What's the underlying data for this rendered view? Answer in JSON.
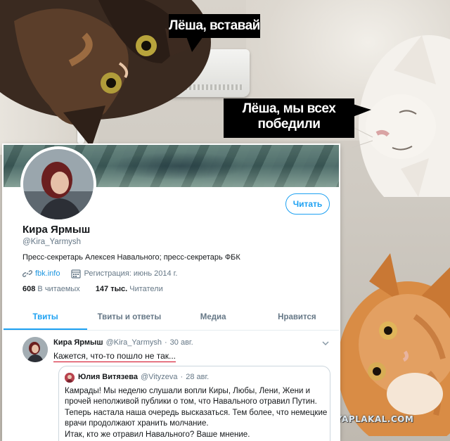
{
  "meme": {
    "caption_top": "Лёша, вставай",
    "caption_middle": "Лёша, мы всех победили",
    "watermark": "YAPLAKAL.COM"
  },
  "profile": {
    "follow_label": "Читать",
    "name": "Кира Ярмыш",
    "handle": "@Kira_Yarmysh",
    "bio": "Пресс-секретарь Алексея Навального; пресс-секретарь ФБК",
    "website": "fbk.info",
    "joined": "Регистрация: июнь 2014 г.",
    "following_count": "608",
    "following_label": "В читаемых",
    "followers_count": "147 тыс.",
    "followers_label": "Читатели"
  },
  "tabs": [
    {
      "label": "Твиты",
      "active": true
    },
    {
      "label": "Твиты и ответы",
      "active": false
    },
    {
      "label": "Медиа",
      "active": false
    },
    {
      "label": "Нравится",
      "active": false
    }
  ],
  "tweet": {
    "author": "Кира Ярмыш",
    "handle": "@Kira_Yarmysh",
    "sep": "·",
    "date": "30 авг.",
    "text": "Кажется, что-то пошло не так...",
    "quote": {
      "author": "Юлия Витязева",
      "handle": "@Vityzeva",
      "sep": "·",
      "date": "28 авг.",
      "text_lines": [
        "Камрады! Мы неделю слушали вопли Киры, Любы, Лени, Жени и",
        "прочей неполживой публики о том, что Навального отравил Путин.",
        "Теперь настала наша очередь высказаться. Тем более, что немецкие",
        "врачи продолжают хранить молчание.",
        "Итак, кто же отравил Навального? Ваше мнение."
      ]
    }
  },
  "colors": {
    "twitter_blue": "#1da1f2",
    "caption_bg": "#000000",
    "underline_red": "#d0021b"
  }
}
